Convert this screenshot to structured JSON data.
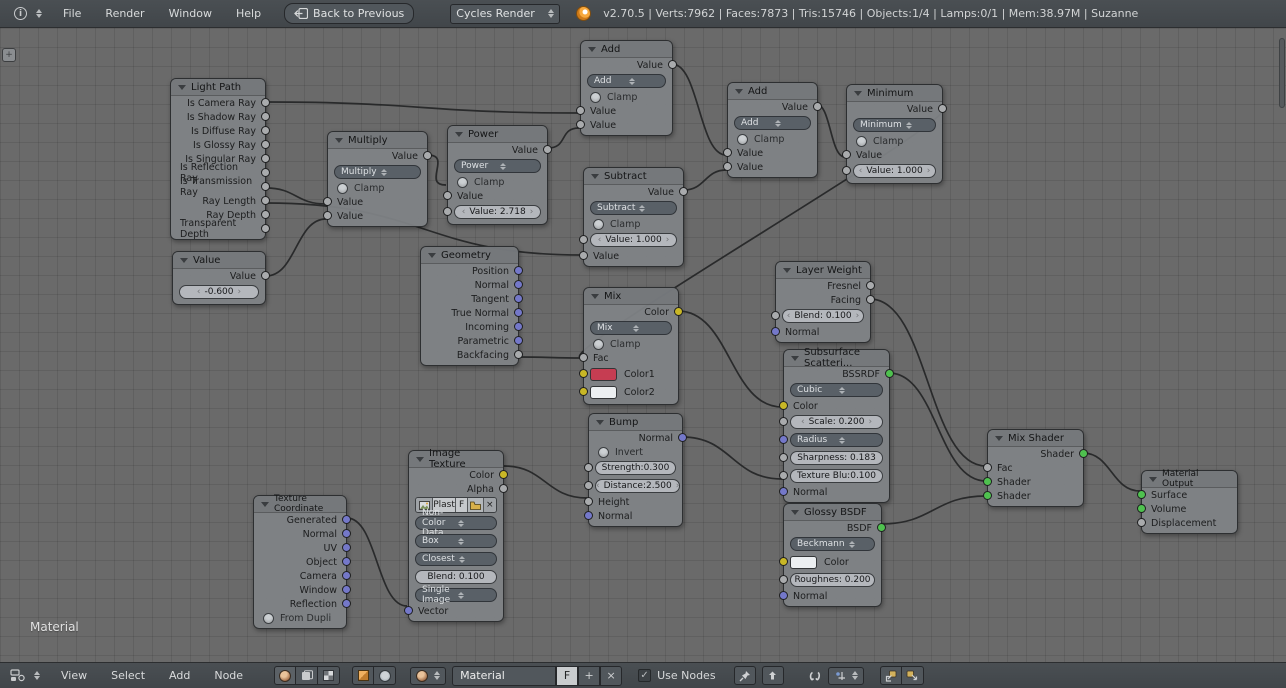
{
  "topbar": {
    "menus": [
      "File",
      "Render",
      "Window",
      "Help"
    ],
    "back_button": "Back to Previous",
    "engine_select": "Cycles Render",
    "stats": "v2.70.5 | Verts:7962 | Faces:7873 | Tris:15746 | Objects:1/4 | Lamps:0/1 | Mem:38.97M | Suzanne"
  },
  "canvas": {
    "label": "Material"
  },
  "colors": {
    "accent_orange": "#f7a83c",
    "socket_value": "#a9abad",
    "socket_color": "#c9b726",
    "socket_vector": "#7478c9",
    "socket_shader": "#4fc14f",
    "mix_color1": "#c63d52",
    "mix_color2": "#eceff1"
  },
  "nodes": {
    "light_path": {
      "title": "Light Path",
      "outputs": [
        "Is Camera Ray",
        "Is Shadow Ray",
        "Is Diffuse Ray",
        "Is Glossy Ray",
        "Is Singular Ray",
        "Is Reflection Ray",
        "Is Transmission Ray",
        "Ray Length",
        "Ray Depth",
        "Transparent Depth"
      ]
    },
    "multiply": {
      "title": "Multiply",
      "output": "Value",
      "op": "Multiply",
      "clamp": "Clamp",
      "in1": "Value",
      "in2": "Value"
    },
    "power": {
      "title": "Power",
      "output": "Value",
      "op": "Power",
      "clamp": "Clamp",
      "in1": "Value",
      "slider": "Value:  2.718"
    },
    "add1": {
      "title": "Add",
      "output": "Value",
      "op": "Add",
      "clamp": "Clamp",
      "in1": "Value",
      "in2": "Value"
    },
    "add2": {
      "title": "Add",
      "output": "Value",
      "op": "Add",
      "clamp": "Clamp",
      "in1": "Value",
      "in2": "Value"
    },
    "minimum": {
      "title": "Minimum",
      "output": "Value",
      "op": "Minimum",
      "clamp": "Clamp",
      "in1": "Value",
      "slider": "Value:  1.000"
    },
    "subtract": {
      "title": "Subtract",
      "output": "Value",
      "op": "Subtract",
      "clamp": "Clamp",
      "slider": "Value:  1.000",
      "in2": "Value"
    },
    "value": {
      "title": "Value",
      "output": "Value",
      "slider": "-0.600"
    },
    "geometry": {
      "title": "Geometry",
      "outputs": [
        "Position",
        "Normal",
        "Tangent",
        "True Normal",
        "Incoming",
        "Parametric",
        "Backfacing"
      ]
    },
    "mix": {
      "title": "Mix",
      "output": "Color",
      "op": "Mix",
      "clamp": "Clamp",
      "fac": "Fac",
      "color1": "Color1",
      "color2": "Color2"
    },
    "layer_weight": {
      "title": "Layer Weight",
      "out1": "Fresnel",
      "out2": "Facing",
      "slider": "Blend:    0.100",
      "input": "Normal"
    },
    "sss": {
      "title": "Subsurface Scatteri...",
      "output": "BSSRDF",
      "falloff": "Cubic",
      "color": "Color",
      "scale": "Scale:      0.200",
      "radius": "Radius",
      "sharpness": "Sharpness: 0.183",
      "texture_blur": "Texture Blu:0.100",
      "normal": "Normal"
    },
    "image_texture": {
      "title": "Image Texture",
      "out1": "Color",
      "out2": "Alpha",
      "image_name": "Plast",
      "fake_user": "F",
      "color_space": "Non-Color Data",
      "projection": "Box",
      "interpolation": "Closest",
      "blend": "Blend:    0.100",
      "source": "Single Image",
      "input": "Vector"
    },
    "tex_coord": {
      "title": "Texture Coordinate",
      "outputs": [
        "Generated",
        "Normal",
        "UV",
        "Object",
        "Camera",
        "Window",
        "Reflection"
      ],
      "checkbox": "From Dupli"
    },
    "bump": {
      "title": "Bump",
      "output": "Normal",
      "invert": "Invert",
      "strength": "Strength:0.300",
      "distance": "Distance:2.500",
      "in1": "Height",
      "in2": "Normal"
    },
    "glossy": {
      "title": "Glossy BSDF",
      "output": "BSDF",
      "distribution": "Beckmann",
      "color": "Color",
      "roughness": "Roughnes: 0.200",
      "normal": "Normal"
    },
    "mix_shader": {
      "title": "Mix Shader",
      "output": "Shader",
      "in1": "Fac",
      "in2": "Shader",
      "in3": "Shader"
    },
    "material_output": {
      "title": "Material Output",
      "in1": "Surface",
      "in2": "Volume",
      "in3": "Displacement"
    }
  },
  "bottombar": {
    "menus": [
      "View",
      "Select",
      "Add",
      "Node"
    ],
    "name_field": "Material",
    "fake_user": "F",
    "use_nodes": "Use Nodes"
  }
}
